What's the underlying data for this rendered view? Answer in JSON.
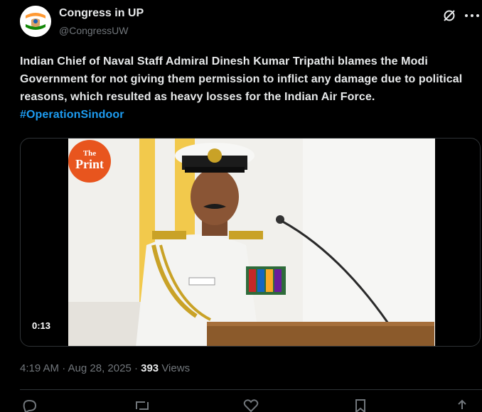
{
  "post": {
    "display_name": "Congress in UP",
    "handle": "@CongressUW",
    "text_main": "Indian Chief of Naval Staff Admiral Dinesh Kumar Tripathi blames the Modi Government for not giving them permission to inflict any damage due to political reasons, which resulted as heavy losses for the Indian Air Force.",
    "hashtag": "#OperationSindoor",
    "video": {
      "duration": "0:13",
      "watermark": "ThePrint"
    },
    "timestamp": "4:19 AM · Aug 28, 2025 · ",
    "views_count": "393",
    "views_label": " Views"
  },
  "icons": {
    "grok": "grok-icon",
    "more": "more-icon",
    "reply": "reply-icon",
    "repost": "repost-icon",
    "like": "like-icon",
    "bookmark": "bookmark-icon",
    "share": "share-icon"
  },
  "colors": {
    "background": "#000000",
    "text": "#e7e9ea",
    "secondary": "#71767b",
    "link": "#1d9bf0",
    "border": "#2f3336",
    "congress_saffron": "#ff9933",
    "congress_green": "#138808"
  }
}
